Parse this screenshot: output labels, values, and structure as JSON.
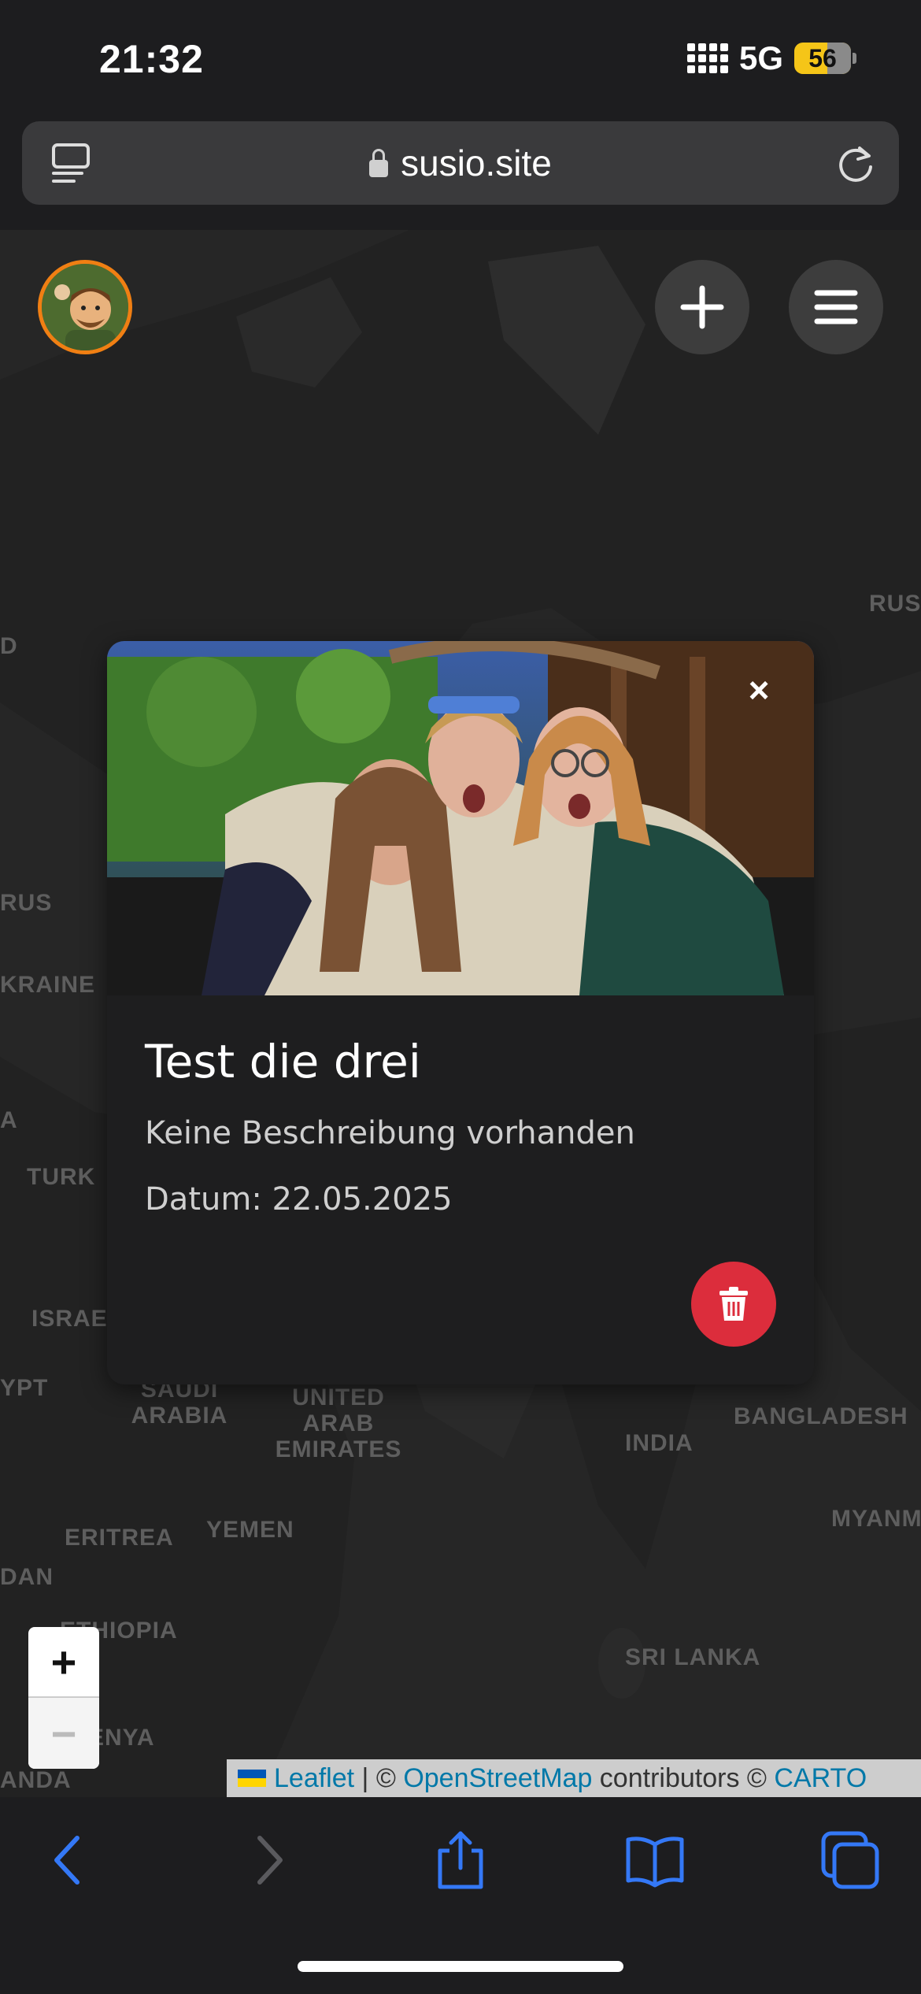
{
  "status_bar": {
    "time": "21:32",
    "network": "5G",
    "battery": "56"
  },
  "browser": {
    "url": "susio.site"
  },
  "map_labels": [
    "RUS",
    "RUS",
    "KRAINE",
    "A",
    "TURK",
    "ISRAE",
    "YPT",
    "SAUDI ARABIA",
    "UNITED ARAB EMIRATES",
    "INDIA",
    "BANGLADESH",
    "MYANM",
    "ERITREA",
    "YEMEN",
    "DAN",
    "ETHIOPIA",
    "SRI LANKA",
    "ENYA",
    "ANDA",
    "D"
  ],
  "popup": {
    "title": "Test die drei",
    "description": "Keine Beschreibung vorhanden",
    "date": "Datum: 22.05.2025",
    "close_label": "×"
  },
  "zoom": {
    "in_label": "+",
    "out_label": "−"
  },
  "attribution": {
    "leaflet": "Leaflet",
    "separator": " | © ",
    "osm": "OpenStreetMap",
    "contributors": " contributors © ",
    "carto": "CARTO"
  },
  "colors": {
    "accent_orange": "#f07f13",
    "delete_red": "#dc2d3c",
    "ios_blue": "#3478f6",
    "link_blue": "#0078a8"
  },
  "icons": [
    "tabs-icon",
    "lock-icon",
    "reload-icon",
    "plus-icon",
    "hamburger-menu-icon",
    "trash-icon",
    "back-icon",
    "forward-icon",
    "share-icon",
    "bookmarks-icon",
    "tabs-overview-icon"
  ]
}
